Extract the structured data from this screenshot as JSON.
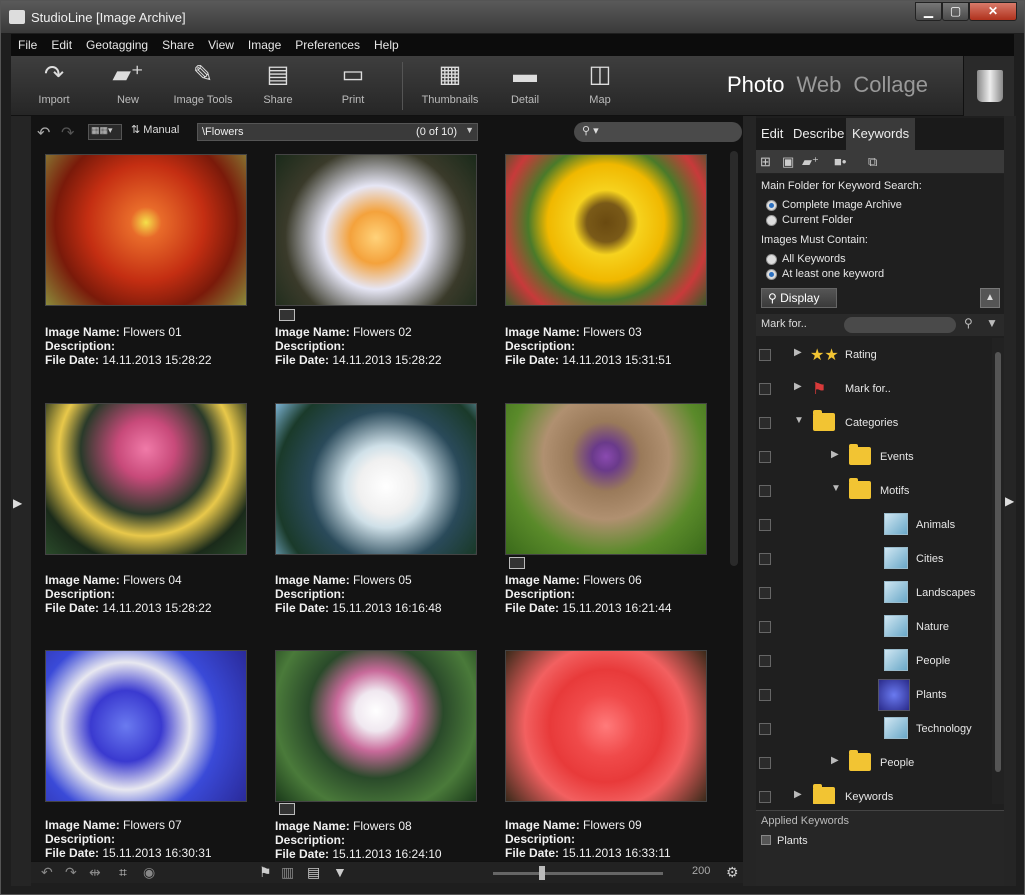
{
  "window": {
    "title": "StudioLine [Image Archive]"
  },
  "menu": [
    "File",
    "Edit",
    "Geotagging",
    "Share",
    "View",
    "Image",
    "Preferences",
    "Help"
  ],
  "toolbar": {
    "tools": [
      {
        "label": "Import",
        "icon": "import-icon"
      },
      {
        "label": "New",
        "icon": "new-folder-icon"
      },
      {
        "label": "Image Tools",
        "icon": "image-tools-icon"
      },
      {
        "label": "Share",
        "icon": "share-icon"
      },
      {
        "label": "Print",
        "icon": "print-icon"
      },
      {
        "label": "Thumbnails",
        "icon": "thumbnails-icon"
      },
      {
        "label": "Detail",
        "icon": "detail-icon"
      },
      {
        "label": "Map",
        "icon": "map-icon"
      }
    ],
    "modes": [
      "Photo",
      "Web",
      "Collage"
    ],
    "active_mode": "Photo"
  },
  "browser": {
    "sort": "Manual",
    "path": "\\Flowers",
    "count": "(0 of 10)",
    "name_label": "Image Name:",
    "desc_label": "Description:",
    "date_label": "File Date:",
    "images": [
      {
        "name": "Flowers 01",
        "date": "14.11.2013 15:28:22"
      },
      {
        "name": "Flowers 02",
        "date": "14.11.2013 15:28:22"
      },
      {
        "name": "Flowers 03",
        "date": "14.11.2013 15:31:51"
      },
      {
        "name": "Flowers 04",
        "date": "14.11.2013 15:28:22"
      },
      {
        "name": "Flowers 05",
        "date": "15.11.2013 16:16:48"
      },
      {
        "name": "Flowers 06",
        "date": "15.11.2013 16:21:44"
      },
      {
        "name": "Flowers 07",
        "date": "15.11.2013 16:30:31"
      },
      {
        "name": "Flowers 08",
        "date": "15.11.2013 16:24:10"
      },
      {
        "name": "Flowers 09",
        "date": "15.11.2013 16:33:11"
      }
    ],
    "zoom": "200"
  },
  "panel": {
    "tabs": [
      "Edit",
      "Describe",
      "Keywords"
    ],
    "active_tab": "Keywords",
    "main_folder_label": "Main Folder for Keyword Search:",
    "folder_options": [
      "Complete Image Archive",
      "Current Folder"
    ],
    "contain_label": "Images Must Contain:",
    "contain_options": [
      "All Keywords",
      "At least one keyword"
    ],
    "display_label": "Display",
    "mark_for_label": "Mark for..",
    "tree": [
      {
        "label": "Rating"
      },
      {
        "label": "Mark for.."
      },
      {
        "label": "Categories"
      },
      {
        "label": "Events"
      },
      {
        "label": "Motifs"
      },
      {
        "label": "Animals"
      },
      {
        "label": "Cities"
      },
      {
        "label": "Landscapes"
      },
      {
        "label": "Nature"
      },
      {
        "label": "People"
      },
      {
        "label": "Plants"
      },
      {
        "label": "Technology"
      },
      {
        "label": "People"
      },
      {
        "label": "Keywords"
      }
    ],
    "applied_label": "Applied Keywords",
    "applied": [
      "Plants"
    ]
  }
}
